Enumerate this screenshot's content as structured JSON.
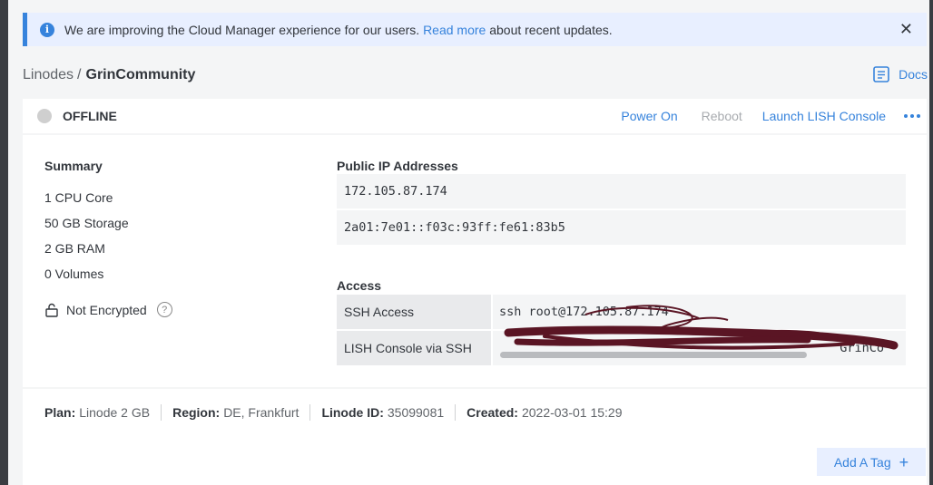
{
  "banner": {
    "text_before": "We are improving the Cloud Manager experience for our users. ",
    "link": "Read more",
    "text_after": " about recent updates."
  },
  "breadcrumb": {
    "parent": "Linodes",
    "separator": "/",
    "current": "GrinCommunity"
  },
  "docs_label": "Docs",
  "status": {
    "label": "OFFLINE",
    "color": "#cfcfcf"
  },
  "actions": {
    "power_on": "Power On",
    "reboot": "Reboot",
    "launch_lish": "Launch LISH Console"
  },
  "summary": {
    "title": "Summary",
    "items": [
      "1 CPU Core",
      "50 GB Storage",
      "2 GB RAM",
      "0 Volumes"
    ],
    "encryption": "Not Encrypted"
  },
  "public_ips": {
    "title": "Public IP Addresses",
    "addresses": [
      "172.105.87.174",
      "2a01:7e01::f03c:93ff:fe61:83b5"
    ]
  },
  "access": {
    "title": "Access",
    "rows": [
      {
        "label": "SSH Access",
        "value": "ssh root@172.105.87.174"
      },
      {
        "label": "LISH Console via SSH",
        "value": "GrinCo"
      }
    ]
  },
  "footer": {
    "plan_label": "Plan:",
    "plan": "Linode 2 GB",
    "region_label": "Region:",
    "region": "DE, Frankfurt",
    "id_label": "Linode ID:",
    "id": "35099081",
    "created_label": "Created:",
    "created": "2022-03-01 15:29"
  },
  "add_tag": "Add A Tag",
  "colors": {
    "accent": "#3683dc",
    "banner_bg": "#e8efff",
    "redaction": "#5a1524"
  }
}
